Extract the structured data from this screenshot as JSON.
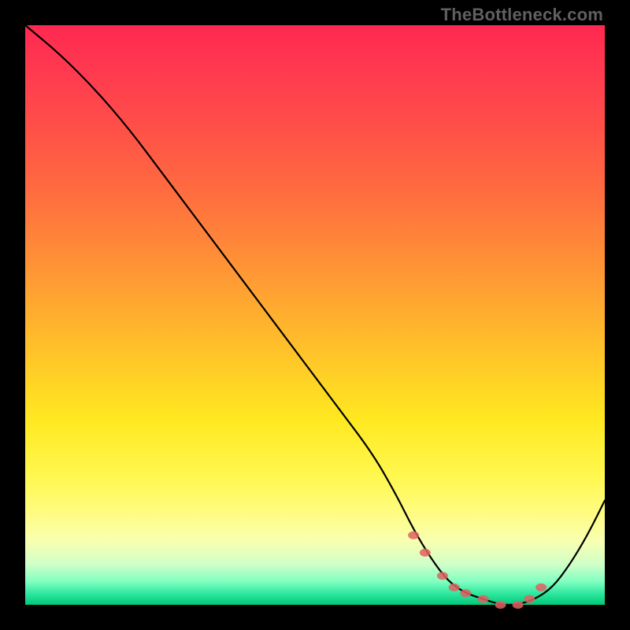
{
  "watermark": "TheBottleneck.com",
  "chart_data": {
    "type": "line",
    "title": "",
    "xlabel": "",
    "ylabel": "",
    "xlim": [
      0,
      100
    ],
    "ylim": [
      0,
      100
    ],
    "series": [
      {
        "name": "bottleneck-curve",
        "x": [
          0,
          6,
          12,
          18,
          24,
          30,
          36,
          42,
          48,
          54,
          60,
          64,
          67,
          70,
          73,
          76,
          79,
          82,
          85,
          88,
          91,
          94,
          97,
          100
        ],
        "y": [
          100,
          95,
          89,
          82,
          74,
          66,
          58,
          50,
          42,
          34,
          26,
          19,
          13,
          8,
          4,
          2,
          1,
          0,
          0,
          1,
          3,
          7,
          12,
          18
        ]
      }
    ],
    "markers": {
      "name": "highlight-dots",
      "x": [
        67,
        69,
        72,
        74,
        76,
        79,
        82,
        85,
        87,
        89
      ],
      "y": [
        12,
        9,
        5,
        3,
        2,
        1,
        0,
        0,
        1,
        3
      ]
    }
  },
  "colors": {
    "curve": "#000000",
    "marker": "#e06060"
  }
}
